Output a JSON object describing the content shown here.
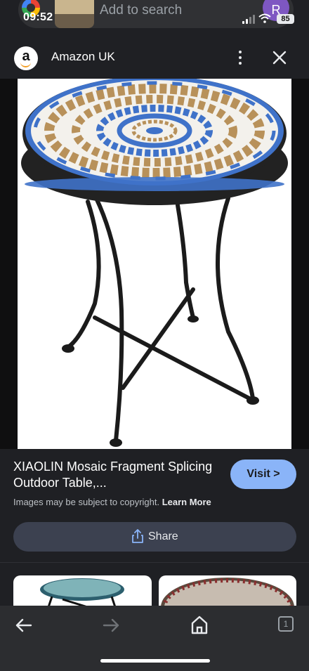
{
  "status_bar": {
    "time": "09:52",
    "battery": "85"
  },
  "search": {
    "placeholder": "Add to search",
    "avatar_letter": "R"
  },
  "header": {
    "source_logo_letter": "a",
    "source_name": "Amazon UK"
  },
  "product": {
    "title": "XIAOLIN Mosaic Fragment Splicing Outdoor Table,...",
    "visit_label": "Visit >"
  },
  "notice": {
    "text": "Images may be subject to copyright. ",
    "link": "Learn More"
  },
  "share": {
    "label": "Share"
  },
  "bottom_nav": {
    "tab_count": "1"
  },
  "colors": {
    "accent": "#8ab4f8",
    "background": "#1f2024",
    "share_button": "#3c4150",
    "mosaic_blue": "#3f72c9",
    "mosaic_tan": "#b8915a"
  },
  "icons": [
    "google-icon",
    "signal-icon",
    "wifi-icon",
    "more-vert-icon",
    "close-icon",
    "share-icon",
    "back-arrow-icon",
    "forward-arrow-icon",
    "home-icon",
    "tabs-icon"
  ]
}
